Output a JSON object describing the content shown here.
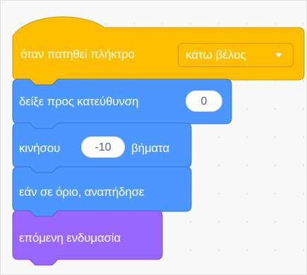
{
  "script": {
    "hat_block": {
      "label": "όταν πατηθεί πλήκτρο",
      "key_dropdown": {
        "value": "κάτω βέλος",
        "arrow_icon": "dropdown-arrow"
      },
      "color": "#FFBF00"
    },
    "point_block": {
      "label": "δείξε προς κατεύθυνση",
      "direction_value": "0",
      "color": "#4C97FF"
    },
    "move_block": {
      "label_before": "κινήσου",
      "steps_value": "-10",
      "label_after": "βήματα",
      "color": "#4C97FF"
    },
    "bounce_block": {
      "label": "εάν σε όριο, αναπήδησε",
      "color": "#4C97FF"
    },
    "costume_block": {
      "label": "επόμενη ενδυμασία",
      "color": "#9966FF"
    }
  }
}
